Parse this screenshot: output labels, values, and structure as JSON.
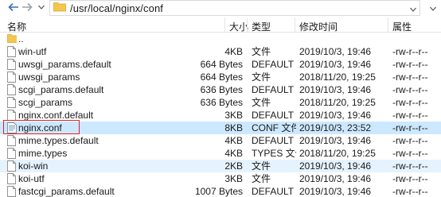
{
  "nav": {
    "path": "/usr/local/nginx/conf",
    "icons": [
      "back-icon",
      "forward-icon",
      "dropdown-icon",
      "folder-icon"
    ]
  },
  "columns": {
    "name": "名称",
    "size": "大小",
    "type": "类型",
    "modified": "修改时间",
    "attrs": "属性"
  },
  "files": [
    {
      "icon": "folder",
      "name": "..",
      "size": "",
      "type": "",
      "modified": "",
      "perms": "",
      "state": "normal"
    },
    {
      "icon": "file",
      "name": "win-utf",
      "size": "4KB",
      "type": "文件",
      "modified": "2019/10/3, 19:46",
      "perms": "-rw-r--r--",
      "state": "normal"
    },
    {
      "icon": "file",
      "name": "uwsgi_params.default",
      "size": "664 Bytes",
      "type": "DEFAULT ...",
      "modified": "2019/10/3, 19:46",
      "perms": "-rw-r--r--",
      "state": "normal"
    },
    {
      "icon": "file",
      "name": "uwsgi_params",
      "size": "664 Bytes",
      "type": "文件",
      "modified": "2018/11/20, 19:25",
      "perms": "-rw-r--r--",
      "state": "normal"
    },
    {
      "icon": "file",
      "name": "scgi_params.default",
      "size": "636 Bytes",
      "type": "DEFAULT ...",
      "modified": "2019/10/3, 19:46",
      "perms": "-rw-r--r--",
      "state": "normal"
    },
    {
      "icon": "file",
      "name": "scgi_params",
      "size": "636 Bytes",
      "type": "文件",
      "modified": "2018/11/20, 19:25",
      "perms": "-rw-r--r--",
      "state": "normal"
    },
    {
      "icon": "file",
      "name": "nginx.conf.default",
      "size": "3KB",
      "type": "DEFAULT ...",
      "modified": "2019/10/3, 19:46",
      "perms": "-rw-r--r--",
      "state": "normal"
    },
    {
      "icon": "conf",
      "name": "nginx.conf",
      "size": "8KB",
      "type": "CONF 文件",
      "modified": "2019/10/3, 23:52",
      "perms": "-rw-r--r--",
      "state": "selected"
    },
    {
      "icon": "file",
      "name": "mime.types.default",
      "size": "4KB",
      "type": "DEFAULT ...",
      "modified": "2019/10/3, 19:46",
      "perms": "-rw-r--r--",
      "state": "normal"
    },
    {
      "icon": "file",
      "name": "mime.types",
      "size": "4KB",
      "type": "TYPES 文件",
      "modified": "2018/11/20, 19:25",
      "perms": "-rw-r--r--",
      "state": "normal"
    },
    {
      "icon": "file",
      "name": "koi-win",
      "size": "2KB",
      "type": "文件",
      "modified": "2019/10/3, 19:46",
      "perms": "-rw-r--r--",
      "state": "hover"
    },
    {
      "icon": "file",
      "name": "koi-utf",
      "size": "3KB",
      "type": "文件",
      "modified": "2019/10/3, 19:46",
      "perms": "-rw-r--r--",
      "state": "normal"
    },
    {
      "icon": "file",
      "name": "fastcgi_params.default",
      "size": "1007 Bytes",
      "type": "DEFAULT ...",
      "modified": "2019/10/3, 19:46",
      "perms": "-rw-r--r--",
      "state": "normal"
    }
  ],
  "colors": {
    "selected_row": "#cce8ff",
    "hover_row": "#e5f3ff",
    "highlight_box": "#e0202b",
    "folder": "#f4c64e"
  }
}
